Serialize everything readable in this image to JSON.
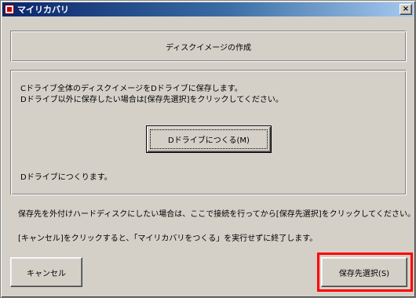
{
  "window": {
    "title": "マイリカバリ",
    "close_glyph": "×",
    "icons": {
      "app": "my-recovery-app-icon",
      "close": "close-x-icon"
    }
  },
  "header": {
    "title": "ディスクイメージの作成"
  },
  "main": {
    "description_line1": "Cドライブ全体のディスクイメージをDドライブに保存します。",
    "description_line2": "Dドライブ以外に保存したい場合は[保存先選択]をクリックしてください。",
    "create_button_label": "Dドライブにつくる(M)",
    "status_text": "Dドライブにつくります。"
  },
  "info": {
    "external_hdd_note": "保存先を外付けハードディスクにしたい場合は、ここで接続を行ってから[保存先選択]をクリックしてください。",
    "cancel_note": "[キャンセル]をクリックすると、「マイリカバリをつくる」を実行せずに終了します。"
  },
  "footer": {
    "cancel_label": "キャンセル",
    "select_destination_label": "保存先選択(S)"
  },
  "colors": {
    "dialog_bg": "#d4d0c8",
    "titlebar_start": "#0a246a",
    "titlebar_end": "#a6caf0",
    "highlight": "#ff0000"
  }
}
